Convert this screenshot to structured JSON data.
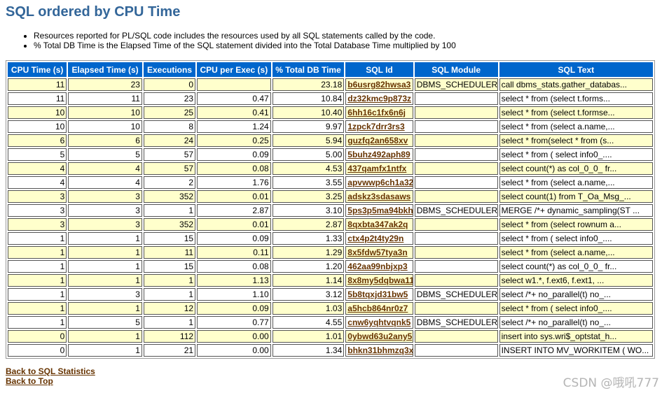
{
  "page": {
    "title": "SQL ordered by CPU Time",
    "notes": [
      "Resources reported for PL/SQL code includes the resources used by all SQL statements called by the code.",
      "% Total DB Time is the Elapsed Time of the SQL statement divided into the Total Database Time multiplied by 100"
    ]
  },
  "table": {
    "headers": [
      "CPU Time (s)",
      "Elapsed Time (s)",
      "Executions",
      "CPU per Exec (s)",
      "% Total DB Time",
      "SQL Id",
      "SQL Module",
      "SQL Text"
    ],
    "rows": [
      [
        "11",
        "23",
        "0",
        "",
        "23.18",
        "b6usrg82hwsa3",
        "DBMS_SCHEDULER",
        "call dbms_stats.gather_databas..."
      ],
      [
        "11",
        "11",
        "23",
        "0.47",
        "10.84",
        "dz32kmc9p873z",
        "",
        "select * from (select t.forms..."
      ],
      [
        "10",
        "10",
        "25",
        "0.41",
        "10.40",
        "6hh16c1fx6n6j",
        "",
        "select * from (select t.formse..."
      ],
      [
        "10",
        "10",
        "8",
        "1.24",
        "9.97",
        "1zpck7drr3rs3",
        "",
        "select * from (select a.name,..."
      ],
      [
        "6",
        "6",
        "24",
        "0.25",
        "5.94",
        "guzfq2an658xv",
        "",
        "select * from(select * from (s..."
      ],
      [
        "5",
        "5",
        "57",
        "0.09",
        "5.00",
        "5buhz492aph89",
        "",
        "select * from ( select info0_...."
      ],
      [
        "4",
        "4",
        "57",
        "0.08",
        "4.53",
        "437qamfx1ntfx",
        "",
        "select count(*) as col_0_0_ fr..."
      ],
      [
        "4",
        "4",
        "2",
        "1.76",
        "3.55",
        "apvwwp6ch1a32",
        "",
        "select * from (select a.name,..."
      ],
      [
        "3",
        "3",
        "352",
        "0.01",
        "3.25",
        "adskz3sdasaws",
        "",
        "select count(1) from T_Oa_Msg_..."
      ],
      [
        "3",
        "3",
        "1",
        "2.87",
        "3.10",
        "5ps3p5ma94bkh",
        "DBMS_SCHEDULER",
        "MERGE /*+ dynamic_sampling(ST ..."
      ],
      [
        "3",
        "3",
        "352",
        "0.01",
        "2.87",
        "8qxbta347ak2q",
        "",
        "select * from (select rownum a..."
      ],
      [
        "1",
        "1",
        "15",
        "0.09",
        "1.33",
        "ctx4p2t4ty29n",
        "",
        "select * from ( select info0_...."
      ],
      [
        "1",
        "1",
        "11",
        "0.11",
        "1.29",
        "8x5fdw57tya3n",
        "",
        "select * from (select a.name,..."
      ],
      [
        "1",
        "1",
        "15",
        "0.08",
        "1.20",
        "462aa99nbjxp3",
        "",
        "select count(*) as col_0_0_ fr..."
      ],
      [
        "1",
        "1",
        "1",
        "1.13",
        "1.14",
        "8x8my5dqbwa11",
        "",
        "select w1.*, f.ext6, f.ext1, ..."
      ],
      [
        "1",
        "3",
        "1",
        "1.10",
        "3.12",
        "5b8tqxjd31bw5",
        "DBMS_SCHEDULER",
        "select /*+ no_parallel(t) no_..."
      ],
      [
        "1",
        "1",
        "12",
        "0.09",
        "1.03",
        "a5hcb864nr0z7",
        "",
        "select * from ( select info0_...."
      ],
      [
        "1",
        "5",
        "1",
        "0.77",
        "4.55",
        "cnw6yqhtvqnk5",
        "DBMS_SCHEDULER",
        "select /*+ no_parallel(t) no_..."
      ],
      [
        "0",
        "1",
        "112",
        "0.00",
        "1.01",
        "0ybwd63u2any5",
        "",
        "insert into sys.wri$_optstat_h..."
      ],
      [
        "0",
        "1",
        "21",
        "0.00",
        "1.34",
        "bhkn31bhmzq3x",
        "",
        "INSERT INTO MV_WORKITEM ( WO..."
      ]
    ]
  },
  "links": {
    "back_sql_statistics": "Back to SQL Statistics",
    "back_top": "Back to Top"
  },
  "watermark": "CSDN @哦吼777",
  "colors": {
    "title": "#336699",
    "header_bg": "#0066CC",
    "row_highlight": "#FFFFCC",
    "link": "#663300"
  }
}
